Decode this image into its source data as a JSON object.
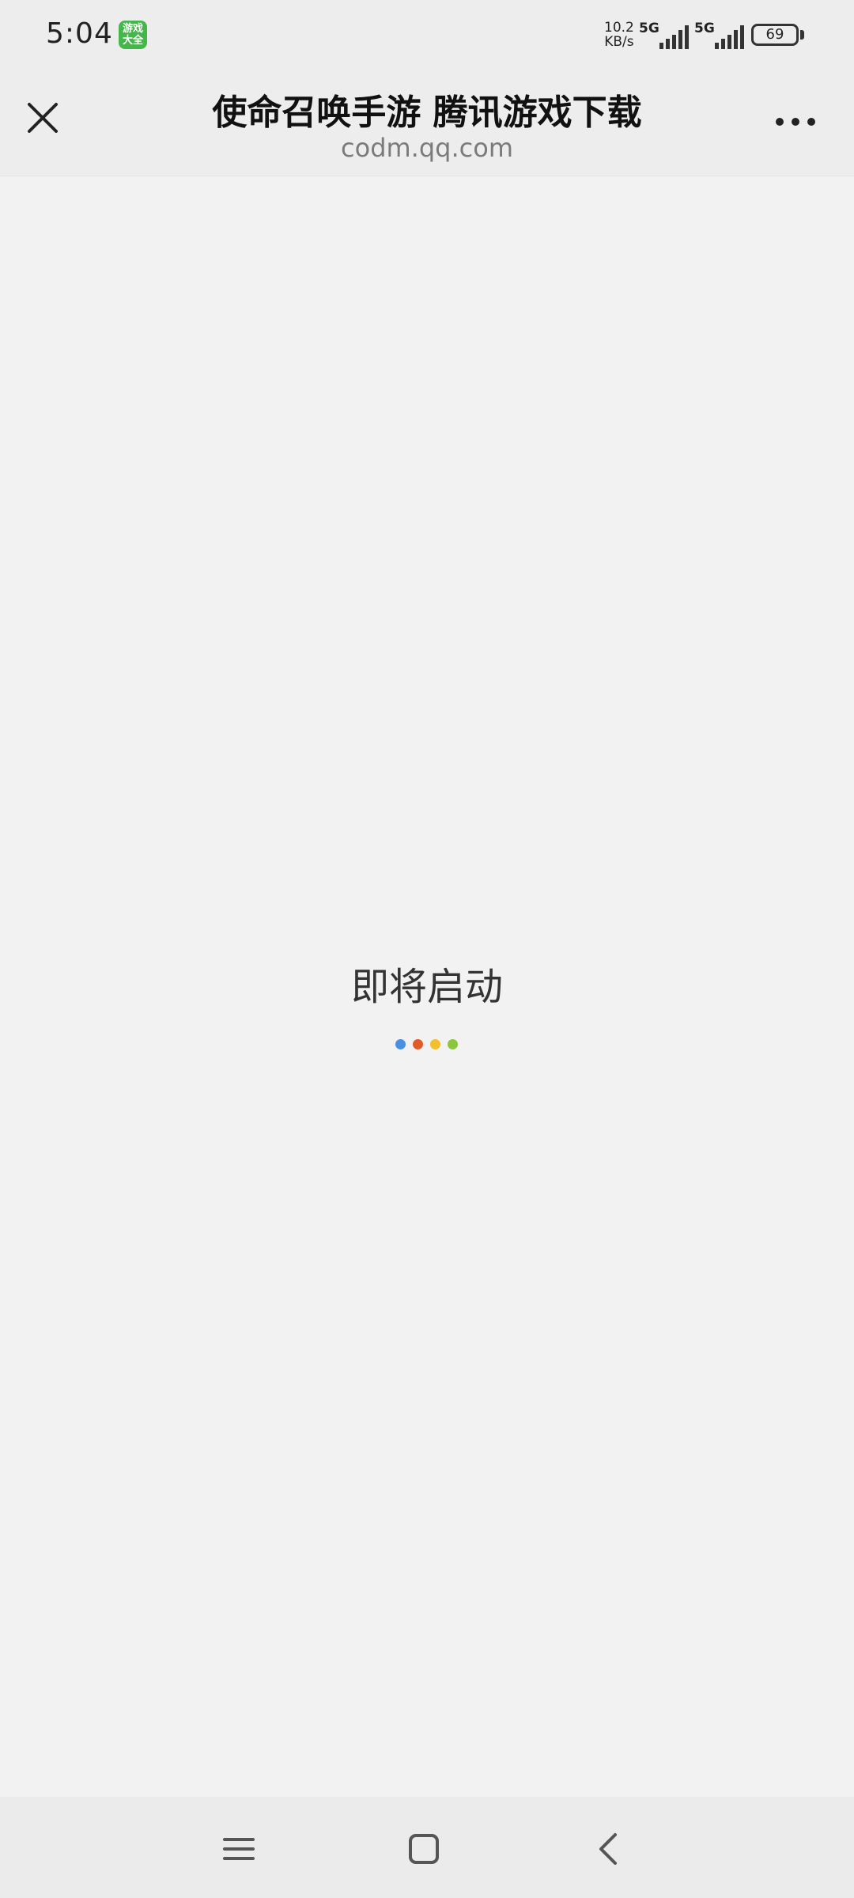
{
  "status_bar": {
    "time": "5:04",
    "app_icon_label_top": "游戏",
    "app_icon_label_bottom": "大全",
    "net_speed_value": "10.2",
    "net_speed_unit": "KB/s",
    "signal_1_label": "5G",
    "signal_2_label": "5G",
    "battery_level": "69"
  },
  "title_bar": {
    "title": "使命召唤手游 腾讯游戏下载",
    "domain": "codm.qq.com"
  },
  "loading": {
    "text": "即将启动",
    "dot_colors": [
      "#4a90e2",
      "#e05a2b",
      "#f2c02c",
      "#8cc63e"
    ]
  },
  "icons": {
    "close": "close-icon",
    "more": "more-icon",
    "menu": "menu-icon",
    "home": "home-icon",
    "back": "back-icon"
  }
}
